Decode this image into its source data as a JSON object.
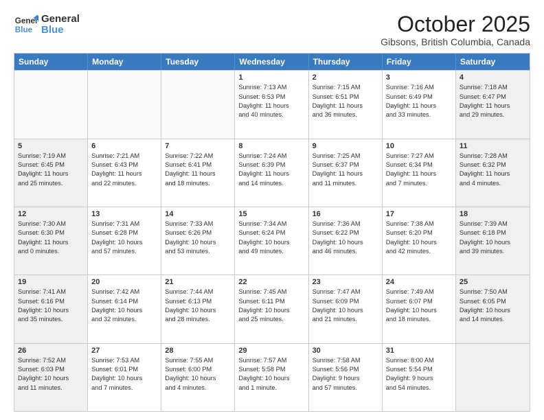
{
  "header": {
    "logo_line1": "General",
    "logo_line2": "Blue",
    "title": "October 2025",
    "subtitle": "Gibsons, British Columbia, Canada"
  },
  "days_of_week": [
    "Sunday",
    "Monday",
    "Tuesday",
    "Wednesday",
    "Thursday",
    "Friday",
    "Saturday"
  ],
  "rows": [
    [
      {
        "day": "",
        "info": "",
        "shaded": false,
        "empty": true
      },
      {
        "day": "",
        "info": "",
        "shaded": false,
        "empty": true
      },
      {
        "day": "",
        "info": "",
        "shaded": false,
        "empty": true
      },
      {
        "day": "1",
        "info": "Sunrise: 7:13 AM\nSunset: 6:53 PM\nDaylight: 11 hours\nand 40 minutes.",
        "shaded": false,
        "empty": false
      },
      {
        "day": "2",
        "info": "Sunrise: 7:15 AM\nSunset: 6:51 PM\nDaylight: 11 hours\nand 36 minutes.",
        "shaded": false,
        "empty": false
      },
      {
        "day": "3",
        "info": "Sunrise: 7:16 AM\nSunset: 6:49 PM\nDaylight: 11 hours\nand 33 minutes.",
        "shaded": false,
        "empty": false
      },
      {
        "day": "4",
        "info": "Sunrise: 7:18 AM\nSunset: 6:47 PM\nDaylight: 11 hours\nand 29 minutes.",
        "shaded": true,
        "empty": false
      }
    ],
    [
      {
        "day": "5",
        "info": "Sunrise: 7:19 AM\nSunset: 6:45 PM\nDaylight: 11 hours\nand 25 minutes.",
        "shaded": true,
        "empty": false
      },
      {
        "day": "6",
        "info": "Sunrise: 7:21 AM\nSunset: 6:43 PM\nDaylight: 11 hours\nand 22 minutes.",
        "shaded": false,
        "empty": false
      },
      {
        "day": "7",
        "info": "Sunrise: 7:22 AM\nSunset: 6:41 PM\nDaylight: 11 hours\nand 18 minutes.",
        "shaded": false,
        "empty": false
      },
      {
        "day": "8",
        "info": "Sunrise: 7:24 AM\nSunset: 6:39 PM\nDaylight: 11 hours\nand 14 minutes.",
        "shaded": false,
        "empty": false
      },
      {
        "day": "9",
        "info": "Sunrise: 7:25 AM\nSunset: 6:37 PM\nDaylight: 11 hours\nand 11 minutes.",
        "shaded": false,
        "empty": false
      },
      {
        "day": "10",
        "info": "Sunrise: 7:27 AM\nSunset: 6:34 PM\nDaylight: 11 hours\nand 7 minutes.",
        "shaded": false,
        "empty": false
      },
      {
        "day": "11",
        "info": "Sunrise: 7:28 AM\nSunset: 6:32 PM\nDaylight: 11 hours\nand 4 minutes.",
        "shaded": true,
        "empty": false
      }
    ],
    [
      {
        "day": "12",
        "info": "Sunrise: 7:30 AM\nSunset: 6:30 PM\nDaylight: 11 hours\nand 0 minutes.",
        "shaded": true,
        "empty": false
      },
      {
        "day": "13",
        "info": "Sunrise: 7:31 AM\nSunset: 6:28 PM\nDaylight: 10 hours\nand 57 minutes.",
        "shaded": false,
        "empty": false
      },
      {
        "day": "14",
        "info": "Sunrise: 7:33 AM\nSunset: 6:26 PM\nDaylight: 10 hours\nand 53 minutes.",
        "shaded": false,
        "empty": false
      },
      {
        "day": "15",
        "info": "Sunrise: 7:34 AM\nSunset: 6:24 PM\nDaylight: 10 hours\nand 49 minutes.",
        "shaded": false,
        "empty": false
      },
      {
        "day": "16",
        "info": "Sunrise: 7:36 AM\nSunset: 6:22 PM\nDaylight: 10 hours\nand 46 minutes.",
        "shaded": false,
        "empty": false
      },
      {
        "day": "17",
        "info": "Sunrise: 7:38 AM\nSunset: 6:20 PM\nDaylight: 10 hours\nand 42 minutes.",
        "shaded": false,
        "empty": false
      },
      {
        "day": "18",
        "info": "Sunrise: 7:39 AM\nSunset: 6:18 PM\nDaylight: 10 hours\nand 39 minutes.",
        "shaded": true,
        "empty": false
      }
    ],
    [
      {
        "day": "19",
        "info": "Sunrise: 7:41 AM\nSunset: 6:16 PM\nDaylight: 10 hours\nand 35 minutes.",
        "shaded": true,
        "empty": false
      },
      {
        "day": "20",
        "info": "Sunrise: 7:42 AM\nSunset: 6:14 PM\nDaylight: 10 hours\nand 32 minutes.",
        "shaded": false,
        "empty": false
      },
      {
        "day": "21",
        "info": "Sunrise: 7:44 AM\nSunset: 6:13 PM\nDaylight: 10 hours\nand 28 minutes.",
        "shaded": false,
        "empty": false
      },
      {
        "day": "22",
        "info": "Sunrise: 7:45 AM\nSunset: 6:11 PM\nDaylight: 10 hours\nand 25 minutes.",
        "shaded": false,
        "empty": false
      },
      {
        "day": "23",
        "info": "Sunrise: 7:47 AM\nSunset: 6:09 PM\nDaylight: 10 hours\nand 21 minutes.",
        "shaded": false,
        "empty": false
      },
      {
        "day": "24",
        "info": "Sunrise: 7:49 AM\nSunset: 6:07 PM\nDaylight: 10 hours\nand 18 minutes.",
        "shaded": false,
        "empty": false
      },
      {
        "day": "25",
        "info": "Sunrise: 7:50 AM\nSunset: 6:05 PM\nDaylight: 10 hours\nand 14 minutes.",
        "shaded": true,
        "empty": false
      }
    ],
    [
      {
        "day": "26",
        "info": "Sunrise: 7:52 AM\nSunset: 6:03 PM\nDaylight: 10 hours\nand 11 minutes.",
        "shaded": true,
        "empty": false
      },
      {
        "day": "27",
        "info": "Sunrise: 7:53 AM\nSunset: 6:01 PM\nDaylight: 10 hours\nand 7 minutes.",
        "shaded": false,
        "empty": false
      },
      {
        "day": "28",
        "info": "Sunrise: 7:55 AM\nSunset: 6:00 PM\nDaylight: 10 hours\nand 4 minutes.",
        "shaded": false,
        "empty": false
      },
      {
        "day": "29",
        "info": "Sunrise: 7:57 AM\nSunset: 5:58 PM\nDaylight: 10 hours\nand 1 minute.",
        "shaded": false,
        "empty": false
      },
      {
        "day": "30",
        "info": "Sunrise: 7:58 AM\nSunset: 5:56 PM\nDaylight: 9 hours\nand 57 minutes.",
        "shaded": false,
        "empty": false
      },
      {
        "day": "31",
        "info": "Sunrise: 8:00 AM\nSunset: 5:54 PM\nDaylight: 9 hours\nand 54 minutes.",
        "shaded": false,
        "empty": false
      },
      {
        "day": "",
        "info": "",
        "shaded": true,
        "empty": true
      }
    ]
  ]
}
